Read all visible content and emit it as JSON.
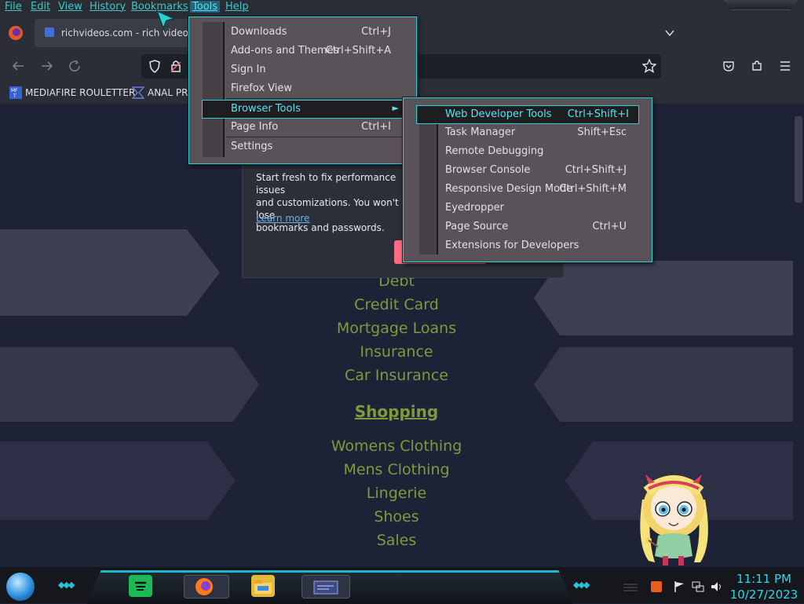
{
  "menubar": {
    "items": [
      {
        "label": "File"
      },
      {
        "label": "Edit"
      },
      {
        "label": "View"
      },
      {
        "label": "History"
      },
      {
        "label": "Bookmarks"
      },
      {
        "label": "Tools"
      },
      {
        "label": "Help"
      }
    ]
  },
  "tab": {
    "title": "richvideos.com - rich videos R",
    "icon": "firefox-icon"
  },
  "bookmarks": [
    {
      "label": "MEDIAFIRE ROULETTER",
      "icon": "mediafire-icon"
    },
    {
      "label": "ANAL PRO",
      "icon": "bookmark-icon"
    }
  ],
  "popup": {
    "body": "Start fresh to fix performance issues and customizations. You won't lose bookmarks and passwords.",
    "line1": "Start fresh to fix performance issues",
    "line2": "and customizations. You won't lose",
    "line3": "bookmarks and passwords.",
    "link": "Learn more"
  },
  "tools_menu": {
    "items": [
      {
        "label": "Downloads",
        "shortcut": "Ctrl+J"
      },
      {
        "label": "Add-ons and Themes",
        "shortcut": "Ctrl+Shift+A"
      },
      {
        "label": "Sign In",
        "shortcut": ""
      },
      {
        "label": "Firefox View",
        "shortcut": ""
      },
      {
        "label": "Browser Tools",
        "shortcut": ""
      },
      {
        "label": "Page Info",
        "shortcut": "Ctrl+I"
      },
      {
        "label": "Settings",
        "shortcut": ""
      }
    ]
  },
  "browser_tools_menu": {
    "items": [
      {
        "label": "Web Developer Tools",
        "shortcut": "Ctrl+Shift+I"
      },
      {
        "label": "Task Manager",
        "shortcut": "Shift+Esc"
      },
      {
        "label": "Remote Debugging",
        "shortcut": ""
      },
      {
        "label": "Browser Console",
        "shortcut": "Ctrl+Shift+J"
      },
      {
        "label": "Responsive Design Mode",
        "shortcut": "Ctrl+Shift+M"
      },
      {
        "label": "Eyedropper",
        "shortcut": ""
      },
      {
        "label": "Page Source",
        "shortcut": "Ctrl+U"
      },
      {
        "label": "Extensions for Developers",
        "shortcut": ""
      }
    ]
  },
  "page": {
    "links_top": [
      "Debt",
      "Credit Card",
      "Mortgage Loans",
      "Insurance",
      "Car Insurance"
    ],
    "section_heading": "Shopping",
    "links_bottom": [
      "Womens Clothing",
      "Mens Clothing",
      "Lingerie",
      "Shoes",
      "Sales"
    ]
  },
  "taskbar": {
    "time": "11:11 PM",
    "date": "10/27/2023",
    "apps": [
      "spotify-icon",
      "firefox-icon",
      "file-explorer-icon",
      "window-app-icon"
    ]
  },
  "colors": {
    "accent": "#2ad0d6",
    "link_green": "#7e9a3c",
    "page_bg": "#1e2236",
    "menu_bg": "#5a5259"
  }
}
